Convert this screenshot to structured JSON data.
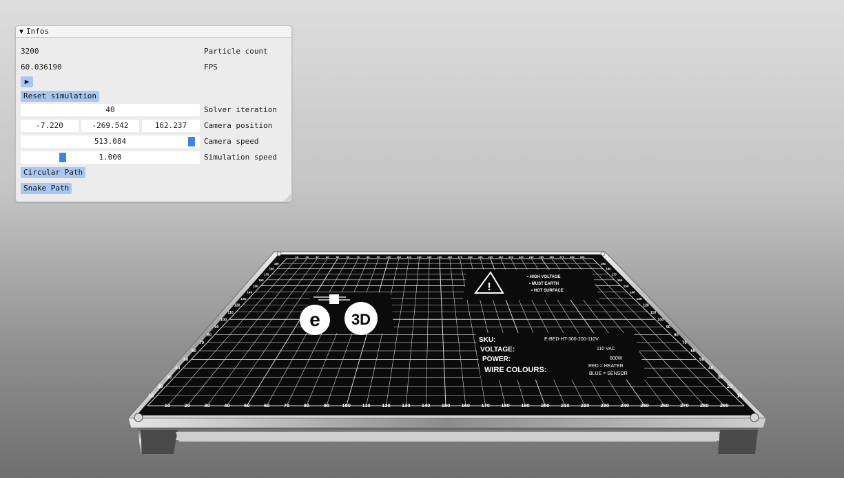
{
  "panel": {
    "title": "Infos",
    "particle_count_value": "3200",
    "particle_count_label": "Particle count",
    "fps_value": "60.036190",
    "fps_label": "FPS",
    "reset_label": "Reset simulation",
    "solver_value": "40",
    "solver_label": "Solver iteration",
    "camera_position": [
      "-7.220",
      "-269.542",
      "162.237"
    ],
    "camera_position_label": "Camera position",
    "camera_speed_value": "513.084",
    "camera_speed_label": "Camera speed",
    "simulation_speed_value": "1.000",
    "simulation_speed_label": "Simulation speed",
    "circular_path_label": "Circular Path",
    "snake_path_label": "Snake Path",
    "camera_speed_slider_level": 0.98,
    "simulation_speed_slider_level": 0.22
  },
  "bed": {
    "logo_text": "e3D",
    "warning_lines": [
      "• HIGH VOLTAGE",
      "• MUST EARTH",
      "• HOT SURFACE"
    ],
    "spec_labels": [
      "SKU:",
      "VOLTAGE:",
      "POWER:",
      "WIRE COLOURS:"
    ],
    "spec_values": [
      "E-BED-HT-300-200-110V",
      "110 VAC",
      "800W",
      "RED = HEATER",
      "BLUE = SENSOR"
    ],
    "x_ticks": [
      "10",
      "20",
      "30",
      "40",
      "50",
      "60",
      "70",
      "80",
      "90",
      "100",
      "110",
      "120",
      "130",
      "140",
      "150",
      "160",
      "170",
      "180",
      "190",
      "200",
      "210",
      "220",
      "230",
      "240",
      "250",
      "260",
      "270",
      "280",
      "290"
    ],
    "y_ticks_left": [
      "10",
      "20",
      "30",
      "40",
      "50",
      "60",
      "70",
      "80",
      "90",
      "100",
      "110",
      "120",
      "130",
      "140",
      "150",
      "160",
      "170",
      "180",
      "190"
    ],
    "y_ticks_right": [
      "10",
      "20",
      "30",
      "40",
      "50",
      "60",
      "70",
      "80",
      "90",
      "100",
      "110",
      "120",
      "130",
      "140",
      "150",
      "160",
      "170",
      "180",
      "190"
    ]
  },
  "colors": {
    "panel_bg": "#ececec",
    "button": "#a9c7f1",
    "slider_grab": "#3d85e0",
    "bed_surface": "#0b0b0b",
    "bed_frame": "#c8c8c8"
  }
}
